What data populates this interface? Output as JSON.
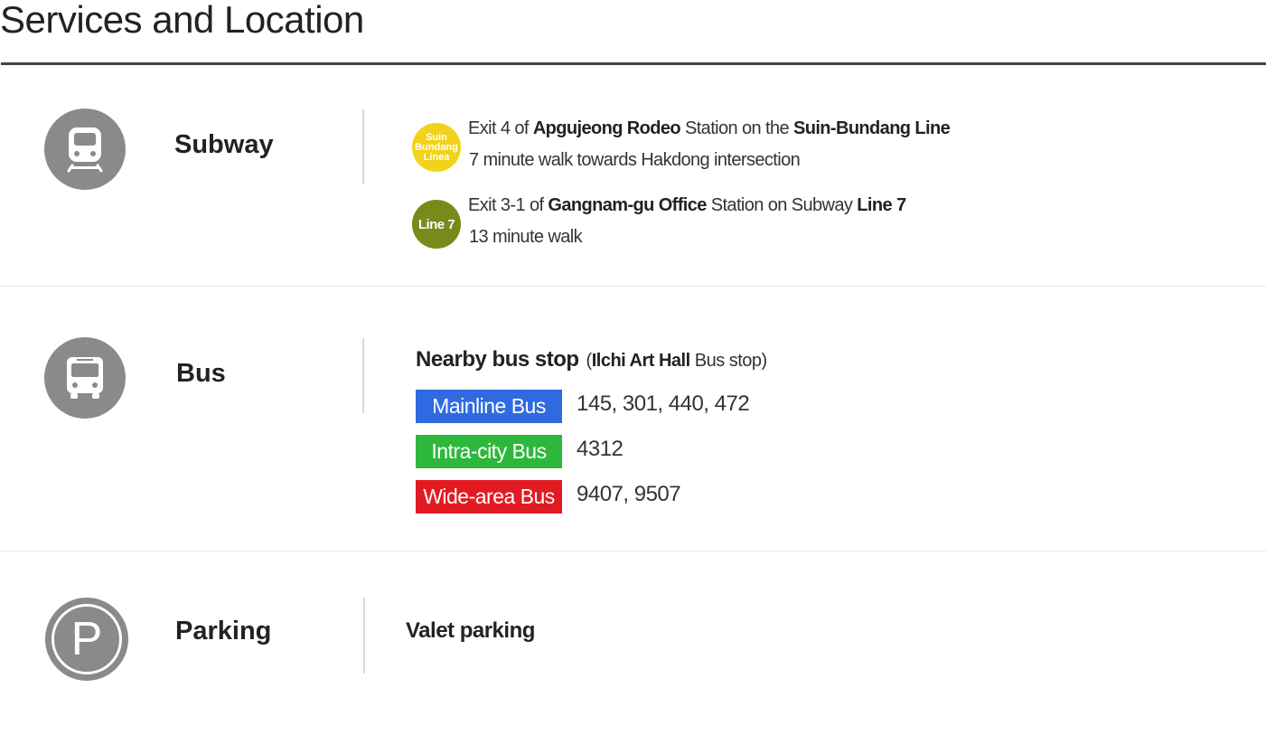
{
  "page": {
    "title": "Services and Location"
  },
  "subway": {
    "label": "Subway",
    "icon": "train-icon",
    "routes": [
      {
        "badge_lines": [
          "Suin",
          "Bundang",
          "Linea"
        ],
        "badge_color": "#f2d31b",
        "line1_prefix": "Exit 4 of ",
        "station": "Apgujeong Rodeo",
        "line1_mid": " Station on the ",
        "line_name": "Suin-Bundang Line",
        "walk": "7 minute walk towards Hakdong intersection"
      },
      {
        "badge_label": "Line 7",
        "badge_color": "#788a1a",
        "line1_prefix": "Exit 3-1 of ",
        "station": "Gangnam-gu Office",
        "line1_mid": " Station on Subway ",
        "line_name": "Line 7",
        "walk": "13 minute walk"
      }
    ]
  },
  "bus": {
    "label": "Bus",
    "icon": "bus-icon",
    "heading": "Nearby bus stop",
    "stop_open": "(",
    "stop_name": "Ilchi Art Hall",
    "stop_suffix": " Bus stop)",
    "types": [
      {
        "label": "Mainline Bus",
        "color": "#2f6ae0",
        "numbers": "145, 301, 440, 472"
      },
      {
        "label": "Intra-city Bus",
        "color": "#2db83d",
        "numbers": "4312"
      },
      {
        "label": "Wide-area Bus",
        "color": "#e21b23",
        "numbers": "9407, 9507"
      }
    ]
  },
  "parking": {
    "label": "Parking",
    "icon": "parking-icon",
    "icon_letter": "P",
    "value": "Valet parking"
  },
  "colors": {
    "icon_gray": "#8a8a8a",
    "rule": "#444444",
    "divider": "#e6e6e6"
  }
}
